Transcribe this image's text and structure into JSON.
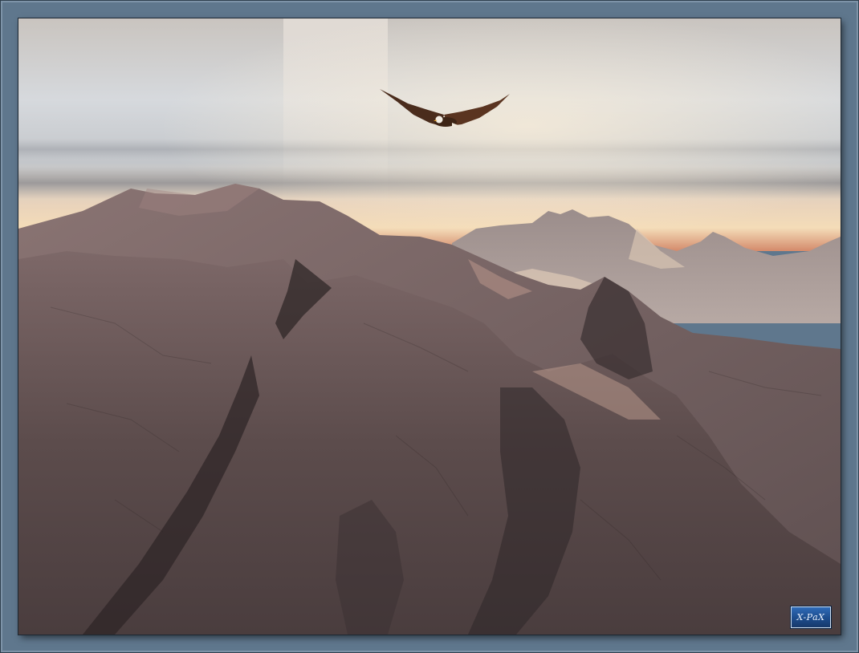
{
  "scene": {
    "subject": "eagle-over-mountains",
    "colors": {
      "frame": "#5f778d",
      "sky_top": "#cfcac4",
      "sky_mid": "#d9dde2",
      "horizon_glow": "#f3d8b4",
      "horizon_red": "#c9735c",
      "rock": "#6d5a5a",
      "rock_dark": "#3f3535",
      "rock_light": "#a48a86"
    }
  },
  "watermark": {
    "text": "X-PaX"
  }
}
